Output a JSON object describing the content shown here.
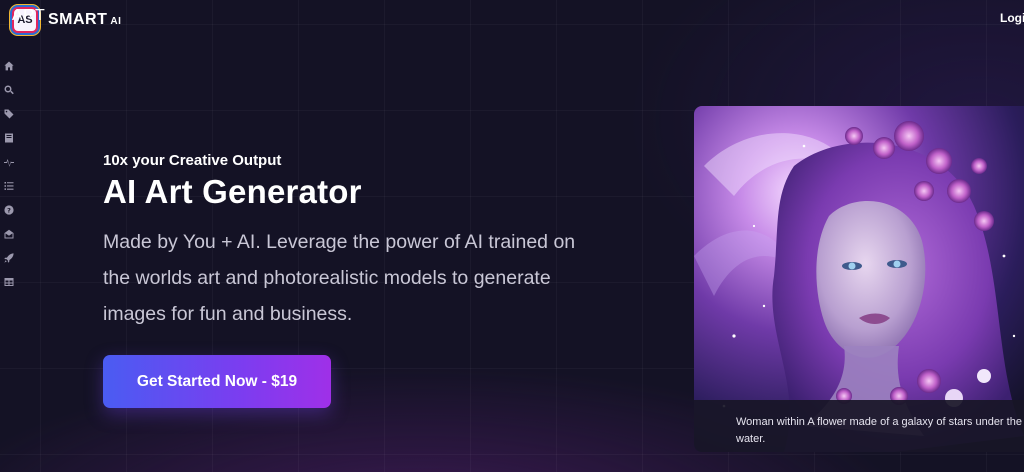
{
  "brand": {
    "badge": "AS",
    "name_light": "ART",
    "name_bold": "SMART",
    "suffix": "AI",
    "colors": {
      "badge_border": "#e2245f",
      "badge_ring_blue": "#2a6fd4",
      "badge_ring_gold": "#f2b832"
    }
  },
  "header": {
    "login_label": "Login"
  },
  "sidebar": {
    "items": [
      {
        "icon": "home-icon"
      },
      {
        "icon": "search-icon"
      },
      {
        "icon": "tags-icon"
      },
      {
        "icon": "book-icon"
      },
      {
        "icon": "activity-icon"
      },
      {
        "icon": "list-icon"
      },
      {
        "icon": "help-icon"
      },
      {
        "icon": "mail-open-icon"
      },
      {
        "icon": "rocket-icon"
      },
      {
        "icon": "table-icon"
      }
    ]
  },
  "hero": {
    "eyebrow": "10x your Creative Output",
    "title": "AI Art Generator",
    "description": "Made by You + AI. Leverage the power of AI trained on the worlds art and photorealistic models to generate images for fun and business.",
    "cta_label": "Get Started Now - $19"
  },
  "showcase": {
    "caption": "Woman within A flower made of a galaxy of stars under the water."
  },
  "theme": {
    "background": "#141225",
    "cta_gradient_start": "#4a5cf2",
    "cta_gradient_end": "#9f30e8"
  }
}
